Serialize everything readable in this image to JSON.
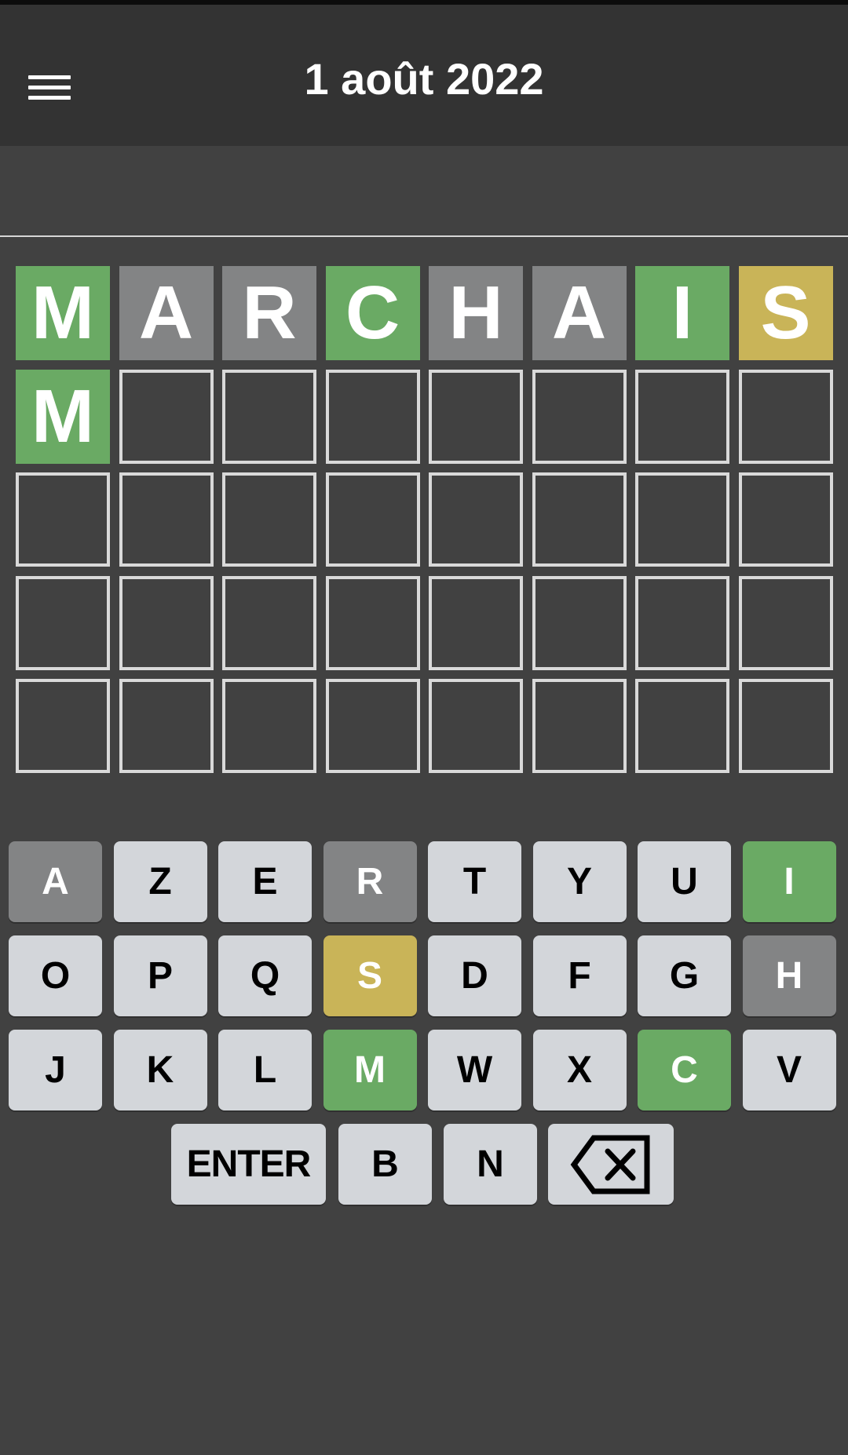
{
  "header": {
    "title": "1 août 2022",
    "menu_icon": "hamburger-menu-icon"
  },
  "board": {
    "rows": [
      [
        {
          "letter": "M",
          "state": "correct"
        },
        {
          "letter": "A",
          "state": "absent"
        },
        {
          "letter": "R",
          "state": "absent"
        },
        {
          "letter": "C",
          "state": "correct"
        },
        {
          "letter": "H",
          "state": "absent"
        },
        {
          "letter": "A",
          "state": "absent"
        },
        {
          "letter": "I",
          "state": "correct"
        },
        {
          "letter": "S",
          "state": "present"
        }
      ],
      [
        {
          "letter": "M",
          "state": "correct"
        },
        {
          "letter": "",
          "state": "empty"
        },
        {
          "letter": "",
          "state": "empty"
        },
        {
          "letter": "",
          "state": "empty"
        },
        {
          "letter": "",
          "state": "empty"
        },
        {
          "letter": "",
          "state": "empty"
        },
        {
          "letter": "",
          "state": "empty"
        },
        {
          "letter": "",
          "state": "empty"
        }
      ],
      [
        {
          "letter": "",
          "state": "empty"
        },
        {
          "letter": "",
          "state": "empty"
        },
        {
          "letter": "",
          "state": "empty"
        },
        {
          "letter": "",
          "state": "empty"
        },
        {
          "letter": "",
          "state": "empty"
        },
        {
          "letter": "",
          "state": "empty"
        },
        {
          "letter": "",
          "state": "empty"
        },
        {
          "letter": "",
          "state": "empty"
        }
      ],
      [
        {
          "letter": "",
          "state": "empty"
        },
        {
          "letter": "",
          "state": "empty"
        },
        {
          "letter": "",
          "state": "empty"
        },
        {
          "letter": "",
          "state": "empty"
        },
        {
          "letter": "",
          "state": "empty"
        },
        {
          "letter": "",
          "state": "empty"
        },
        {
          "letter": "",
          "state": "empty"
        },
        {
          "letter": "",
          "state": "empty"
        }
      ],
      [
        {
          "letter": "",
          "state": "empty"
        },
        {
          "letter": "",
          "state": "empty"
        },
        {
          "letter": "",
          "state": "empty"
        },
        {
          "letter": "",
          "state": "empty"
        },
        {
          "letter": "",
          "state": "empty"
        },
        {
          "letter": "",
          "state": "empty"
        },
        {
          "letter": "",
          "state": "empty"
        },
        {
          "letter": "",
          "state": "empty"
        }
      ]
    ]
  },
  "keyboard": {
    "rows": [
      [
        {
          "label": "A",
          "state": "absent"
        },
        {
          "label": "Z",
          "state": "unused"
        },
        {
          "label": "E",
          "state": "unused"
        },
        {
          "label": "R",
          "state": "absent"
        },
        {
          "label": "T",
          "state": "unused"
        },
        {
          "label": "Y",
          "state": "unused"
        },
        {
          "label": "U",
          "state": "unused"
        },
        {
          "label": "I",
          "state": "correct"
        }
      ],
      [
        {
          "label": "O",
          "state": "unused"
        },
        {
          "label": "P",
          "state": "unused"
        },
        {
          "label": "Q",
          "state": "unused"
        },
        {
          "label": "S",
          "state": "present"
        },
        {
          "label": "D",
          "state": "unused"
        },
        {
          "label": "F",
          "state": "unused"
        },
        {
          "label": "G",
          "state": "unused"
        },
        {
          "label": "H",
          "state": "absent"
        }
      ],
      [
        {
          "label": "J",
          "state": "unused"
        },
        {
          "label": "K",
          "state": "unused"
        },
        {
          "label": "L",
          "state": "unused"
        },
        {
          "label": "M",
          "state": "correct"
        },
        {
          "label": "W",
          "state": "unused"
        },
        {
          "label": "X",
          "state": "unused"
        },
        {
          "label": "C",
          "state": "correct"
        },
        {
          "label": "V",
          "state": "unused"
        }
      ]
    ],
    "bottom_row": {
      "enter_label": "ENTER",
      "keys": [
        {
          "label": "B",
          "state": "unused"
        },
        {
          "label": "N",
          "state": "unused"
        }
      ],
      "backspace_icon": "backspace-icon"
    }
  },
  "colors": {
    "correct": "#6aaa64",
    "present": "#c9b458",
    "absent": "#838485",
    "unused_key": "#d3d6da",
    "background": "#414141",
    "header": "#333333"
  }
}
